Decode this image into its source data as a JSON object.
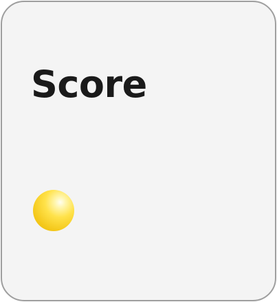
{
  "card": {
    "title": "Score"
  },
  "colors": {
    "card_background": "#f4f4f4",
    "card_border": "#9e9e9e",
    "title_text": "#1a1a1a",
    "coin": "#f4c81a"
  },
  "icons": {
    "coin": "yellow-coin-icon"
  }
}
